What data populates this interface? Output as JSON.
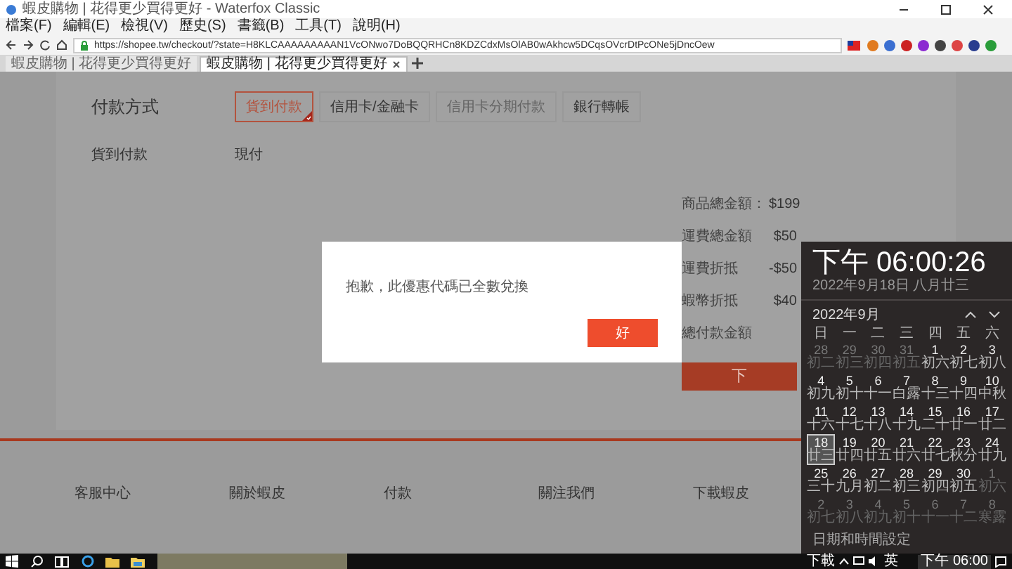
{
  "window": {
    "title": "蝦皮購物 | 花得更少買得更好 - Waterfox Classic"
  },
  "menu": [
    "檔案(F)",
    "編輯(E)",
    "檢視(V)",
    "歷史(S)",
    "書籤(B)",
    "工具(T)",
    "說明(H)"
  ],
  "address_bar": {
    "url": "https://shopee.tw/checkout/?state=H8KLCAAAAAAAAAN1VcONwo7DoBQQRHCn8KDZCdxMsOlAB0wAkhcw5DCqsOVcrDtPcONe5jDncOew"
  },
  "tabs": [
    {
      "title": "蝦皮購物 | 花得更少買得更好",
      "selected": false
    },
    {
      "title": "蝦皮購物 | 花得更少買得更好",
      "selected": true
    }
  ],
  "payment": {
    "heading": "付款方式",
    "options": [
      {
        "label": "貨到付款",
        "selected": true,
        "disabled": false
      },
      {
        "label": "信用卡/金融卡",
        "selected": false,
        "disabled": false
      },
      {
        "label": "信用卡分期付款",
        "selected": false,
        "disabled": true
      },
      {
        "label": "銀行轉帳",
        "selected": false,
        "disabled": false
      }
    ],
    "detail": {
      "label": "貨到付款",
      "value": "現付"
    }
  },
  "summary": {
    "rows": [
      {
        "label": "商品總金額：",
        "value": "$199"
      },
      {
        "label": "運費總金額",
        "value": "$50"
      },
      {
        "label": "運費折抵",
        "value": "-$50"
      },
      {
        "label": "蝦幣折抵",
        "value": "$40"
      },
      {
        "label": "總付款金額",
        "value": ""
      }
    ],
    "place_order_button": "下"
  },
  "dialog": {
    "message": "抱歉，此優惠代碼已全數兌換",
    "button": "好"
  },
  "footer": [
    "客服中心",
    "關於蝦皮",
    "付款",
    "關注我們",
    "下載蝦皮"
  ],
  "calendar": {
    "time": "下午 06:00:26",
    "date": "2022年9月18日 八月廿三",
    "month": "2022年9月",
    "weekdays": [
      "日",
      "一",
      "二",
      "三",
      "四",
      "五",
      "六"
    ],
    "days": [
      {
        "day": "28",
        "lunar": "初二",
        "in_month": false,
        "today": false
      },
      {
        "day": "29",
        "lunar": "初三",
        "in_month": false,
        "today": false
      },
      {
        "day": "30",
        "lunar": "初四",
        "in_month": false,
        "today": false
      },
      {
        "day": "31",
        "lunar": "初五",
        "in_month": false,
        "today": false
      },
      {
        "day": "1",
        "lunar": "初六",
        "in_month": true,
        "today": false
      },
      {
        "day": "2",
        "lunar": "初七",
        "in_month": true,
        "today": false
      },
      {
        "day": "3",
        "lunar": "初八",
        "in_month": true,
        "today": false
      },
      {
        "day": "4",
        "lunar": "初九",
        "in_month": true,
        "today": false
      },
      {
        "day": "5",
        "lunar": "初十",
        "in_month": true,
        "today": false
      },
      {
        "day": "6",
        "lunar": "十一",
        "in_month": true,
        "today": false
      },
      {
        "day": "7",
        "lunar": "白露",
        "in_month": true,
        "today": false
      },
      {
        "day": "8",
        "lunar": "十三",
        "in_month": true,
        "today": false
      },
      {
        "day": "9",
        "lunar": "十四",
        "in_month": true,
        "today": false
      },
      {
        "day": "10",
        "lunar": "中秋",
        "in_month": true,
        "today": false
      },
      {
        "day": "11",
        "lunar": "十六",
        "in_month": true,
        "today": false
      },
      {
        "day": "12",
        "lunar": "十七",
        "in_month": true,
        "today": false
      },
      {
        "day": "13",
        "lunar": "十八",
        "in_month": true,
        "today": false
      },
      {
        "day": "14",
        "lunar": "十九",
        "in_month": true,
        "today": false
      },
      {
        "day": "15",
        "lunar": "二十",
        "in_month": true,
        "today": false
      },
      {
        "day": "16",
        "lunar": "廿一",
        "in_month": true,
        "today": false
      },
      {
        "day": "17",
        "lunar": "廿二",
        "in_month": true,
        "today": false
      },
      {
        "day": "18",
        "lunar": "廿三",
        "in_month": true,
        "today": true
      },
      {
        "day": "19",
        "lunar": "廿四",
        "in_month": true,
        "today": false
      },
      {
        "day": "20",
        "lunar": "廿五",
        "in_month": true,
        "today": false
      },
      {
        "day": "21",
        "lunar": "廿六",
        "in_month": true,
        "today": false
      },
      {
        "day": "22",
        "lunar": "廿七",
        "in_month": true,
        "today": false
      },
      {
        "day": "23",
        "lunar": "秋分",
        "in_month": true,
        "today": false
      },
      {
        "day": "24",
        "lunar": "廿九",
        "in_month": true,
        "today": false
      },
      {
        "day": "25",
        "lunar": "三十",
        "in_month": true,
        "today": false
      },
      {
        "day": "26",
        "lunar": "九月",
        "in_month": true,
        "today": false
      },
      {
        "day": "27",
        "lunar": "初二",
        "in_month": true,
        "today": false
      },
      {
        "day": "28",
        "lunar": "初三",
        "in_month": true,
        "today": false
      },
      {
        "day": "29",
        "lunar": "初四",
        "in_month": true,
        "today": false
      },
      {
        "day": "30",
        "lunar": "初五",
        "in_month": true,
        "today": false
      },
      {
        "day": "1",
        "lunar": "初六",
        "in_month": false,
        "today": false
      },
      {
        "day": "2",
        "lunar": "初七",
        "in_month": false,
        "today": false
      },
      {
        "day": "3",
        "lunar": "初八",
        "in_month": false,
        "today": false
      },
      {
        "day": "4",
        "lunar": "初九",
        "in_month": false,
        "today": false
      },
      {
        "day": "5",
        "lunar": "初十",
        "in_month": false,
        "today": false
      },
      {
        "day": "6",
        "lunar": "十一",
        "in_month": false,
        "today": false
      },
      {
        "day": "7",
        "lunar": "十二",
        "in_month": false,
        "today": false
      },
      {
        "day": "8",
        "lunar": "寒露",
        "in_month": false,
        "today": false
      }
    ],
    "settings_link": "日期和時間設定"
  },
  "taskbar": {
    "tray_label": "下載",
    "ime": "英",
    "clock": "下午 06:00"
  }
}
